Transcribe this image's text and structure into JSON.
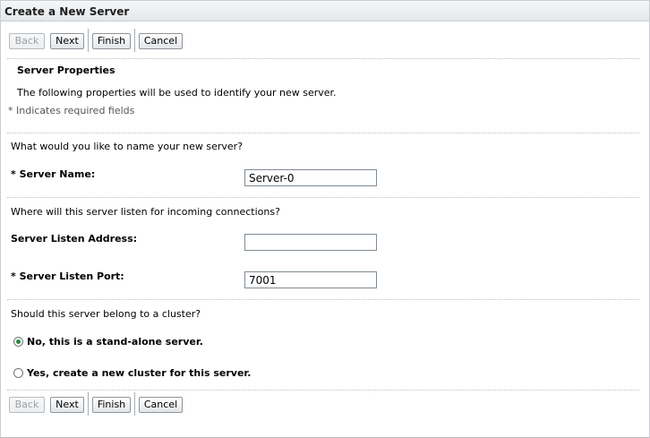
{
  "window": {
    "title": "Create a New Server"
  },
  "toolbar": {
    "back": "Back",
    "next": "Next",
    "finish": "Finish",
    "cancel": "Cancel"
  },
  "section": {
    "title": "Server Properties",
    "description": "The following properties will be used to identify your new server.",
    "required_note": "* Indicates required fields"
  },
  "name_section": {
    "question": "What would you like to name your new server?",
    "server_name_label": "Server Name:",
    "server_name_value": "Server-0"
  },
  "listen_section": {
    "question": "Where will this server listen for incoming connections?",
    "address_label": "Server Listen Address:",
    "address_value": "",
    "port_label": "Server Listen Port:",
    "port_value": "7001"
  },
  "cluster_section": {
    "question": "Should this server belong to a cluster?",
    "option_standalone": "No, this is a stand-alone server.",
    "option_new_cluster": "Yes, create a new cluster for this server.",
    "selected": "standalone"
  },
  "required_marker": "*",
  "colors": {
    "radio_selected": "#2b8a3e",
    "disabled_text": "#9aa0a6"
  }
}
